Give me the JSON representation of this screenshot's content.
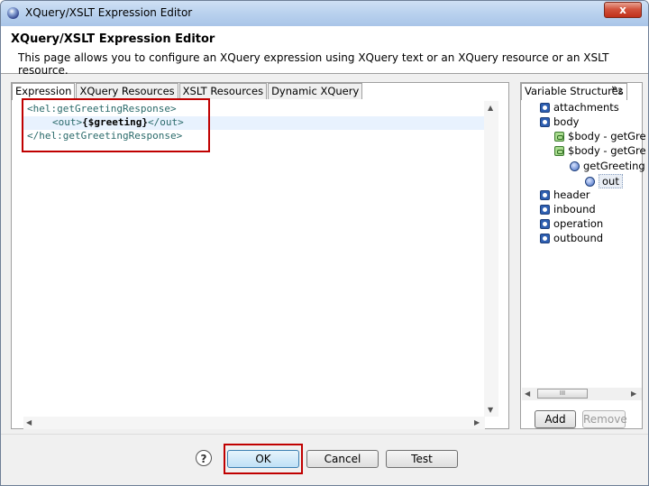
{
  "window": {
    "title": "XQuery/XSLT Expression Editor",
    "close_glyph": "x"
  },
  "header": {
    "title": "XQuery/XSLT Expression Editor",
    "description": "This page allows you to configure an XQuery expression using XQuery text or an XQuery resource or an XSLT resource."
  },
  "tabs": [
    "Expression",
    "XQuery Resources",
    "XSLT Resources",
    "Dynamic XQuery"
  ],
  "editor": {
    "line1": "<hel:getGreetingResponse>",
    "line2_open": "<out>",
    "line2_expr": "{$greeting}",
    "line2_close": "</out>",
    "line3": "</hel:getGreetingResponse>"
  },
  "right_panel": {
    "tab": "Variable Structures",
    "more_tabs": "»",
    "more_count": "2",
    "tree": [
      {
        "label": "attachments",
        "icon": "variable-icon"
      },
      {
        "label": "body",
        "icon": "variable-icon"
      },
      {
        "label": "$body - getGre",
        "icon": "xml-element-icon"
      },
      {
        "label": "$body - getGre",
        "icon": "xml-element-icon"
      },
      {
        "label": "getGreeting",
        "icon": "element-icon"
      },
      {
        "label": "out",
        "icon": "element-icon"
      },
      {
        "label": "header",
        "icon": "variable-icon"
      },
      {
        "label": "inbound",
        "icon": "variable-icon"
      },
      {
        "label": "operation",
        "icon": "variable-icon"
      },
      {
        "label": "outbound",
        "icon": "variable-icon"
      }
    ],
    "add_label": "Add",
    "remove_label": "Remove"
  },
  "footer": {
    "help": "?",
    "ok": "OK",
    "cancel": "Cancel",
    "test": "Test"
  },
  "scroll_thumb_glyph": "III"
}
